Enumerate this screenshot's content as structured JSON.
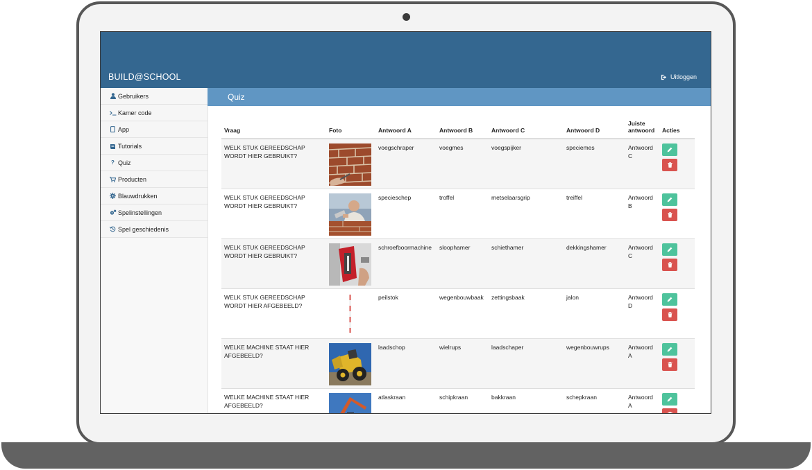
{
  "app": {
    "brand": "BUILD@SCHOOL",
    "logout_label": "Uitloggen"
  },
  "sidebar": {
    "items": [
      {
        "label": "Gebruikers",
        "icon": "user-icon"
      },
      {
        "label": "Kamer code",
        "icon": "terminal-icon"
      },
      {
        "label": "App",
        "icon": "tablet-icon"
      },
      {
        "label": "Tutorials",
        "icon": "book-icon"
      },
      {
        "label": "Quiz",
        "icon": "question-icon"
      },
      {
        "label": "Producten",
        "icon": "cart-icon"
      },
      {
        "label": "Blauwdrukken",
        "icon": "gear-icon"
      },
      {
        "label": "Spelinstellingen",
        "icon": "gears-icon"
      },
      {
        "label": "Spel geschiedenis",
        "icon": "history-icon"
      }
    ]
  },
  "page": {
    "title": "Quiz"
  },
  "table": {
    "headers": {
      "vraag": "Vraag",
      "foto": "Foto",
      "a": "Antwoord A",
      "b": "Antwoord B",
      "c": "Antwoord C",
      "d": "Antwoord D",
      "juiste": "Juiste antwoord",
      "acties": "Acties"
    },
    "rows": [
      {
        "vraag": "WELK STUK GEREEDSCHAP WORDT HIER GEBRUIKT?",
        "a": "voegschraper",
        "b": "voegmes",
        "c": "voegspijker",
        "d": "speciemes",
        "juiste": "Antwoord C",
        "photo": "brick-wall-tool-photo"
      },
      {
        "vraag": "WELK STUK GEREEDSCHAP WORDT HIER GEBRUIKT?",
        "a": "specieschep",
        "b": "troffel",
        "c": "metselaarsgrip",
        "d": "treiffel",
        "juiste": "Antwoord B",
        "photo": "mason-with-trowel-photo"
      },
      {
        "vraag": "WELK STUK GEREEDSCHAP WORDT HIER GEBRUIKT?",
        "a": "schroefboormachine",
        "b": "sloophamer",
        "c": "schiethamer",
        "d": "dekkingshamer",
        "juiste": "Antwoord C",
        "photo": "nail-gun-photo"
      },
      {
        "vraag": "WELK STUK GEREEDSCHAP WORDT HIER AFGEBEELD?",
        "a": "peilstok",
        "b": "wegenbouwbaak",
        "c": "zettingsbaak",
        "d": "jalon",
        "juiste": "Antwoord D",
        "photo": "surveyor-pole-photo"
      },
      {
        "vraag": "WELKE MACHINE STAAT HIER AFGEBEELD?",
        "a": "laadschop",
        "b": "wielrups",
        "c": "laadschaper",
        "d": "wegenbouwrups",
        "juiste": "Antwoord A",
        "photo": "wheel-loader-photo"
      },
      {
        "vraag": "WELKE MACHINE STAAT HIER AFGEBEELD?",
        "a": "atlaskraan",
        "b": "schipkraan",
        "c": "bakkraan",
        "d": "schepkraan",
        "juiste": "Antwoord A",
        "photo": "crane-photo"
      }
    ]
  },
  "colors": {
    "topbar": "#346790",
    "page_header": "#6096c3",
    "edit_button": "#4ec39c",
    "delete_button": "#d9534f"
  }
}
